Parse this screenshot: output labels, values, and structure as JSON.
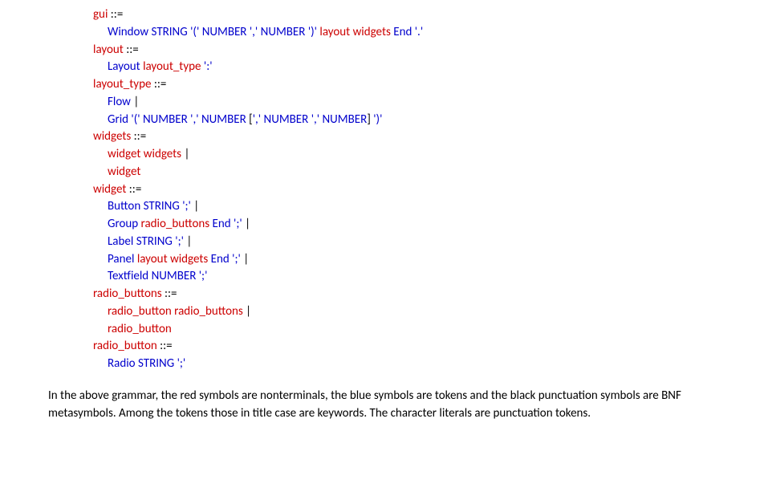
{
  "grammar": {
    "rules": [
      {
        "head": [
          {
            "t": "gui",
            "c": "nt"
          },
          {
            "t": " ",
            "c": "ms"
          },
          {
            "t": "::=",
            "c": "ms"
          }
        ],
        "bodies": [
          [
            {
              "t": "Window",
              "c": "tk"
            },
            {
              "t": " ",
              "c": "ms"
            },
            {
              "t": "STRING",
              "c": "tk"
            },
            {
              "t": " ",
              "c": "ms"
            },
            {
              "t": "'('",
              "c": "tk"
            },
            {
              "t": " ",
              "c": "ms"
            },
            {
              "t": "NUMBER",
              "c": "tk"
            },
            {
              "t": " ",
              "c": "ms"
            },
            {
              "t": "','",
              "c": "tk"
            },
            {
              "t": " ",
              "c": "ms"
            },
            {
              "t": "NUMBER",
              "c": "tk"
            },
            {
              "t": " ",
              "c": "ms"
            },
            {
              "t": "')'",
              "c": "tk"
            },
            {
              "t": " ",
              "c": "ms"
            },
            {
              "t": "layout",
              "c": "nt"
            },
            {
              "t": " ",
              "c": "ms"
            },
            {
              "t": "widgets",
              "c": "nt"
            },
            {
              "t": " ",
              "c": "ms"
            },
            {
              "t": "End",
              "c": "tk"
            },
            {
              "t": " ",
              "c": "ms"
            },
            {
              "t": "'.'",
              "c": "tk"
            }
          ]
        ]
      },
      {
        "head": [
          {
            "t": "layout",
            "c": "nt"
          },
          {
            "t": " ",
            "c": "ms"
          },
          {
            "t": "::=",
            "c": "ms"
          }
        ],
        "bodies": [
          [
            {
              "t": "Layout",
              "c": "tk"
            },
            {
              "t": " ",
              "c": "ms"
            },
            {
              "t": "layout_type",
              "c": "nt"
            },
            {
              "t": " ",
              "c": "ms"
            },
            {
              "t": "':'",
              "c": "tk"
            }
          ]
        ]
      },
      {
        "head": [
          {
            "t": "layout_type",
            "c": "nt"
          },
          {
            "t": " ",
            "c": "ms"
          },
          {
            "t": "::=",
            "c": "ms"
          }
        ],
        "bodies": [
          [
            {
              "t": "Flow",
              "c": "tk"
            },
            {
              "t": " ",
              "c": "ms"
            },
            {
              "t": "|",
              "c": "ms"
            }
          ],
          [
            {
              "t": "Grid",
              "c": "tk"
            },
            {
              "t": " ",
              "c": "ms"
            },
            {
              "t": "'('",
              "c": "tk"
            },
            {
              "t": " ",
              "c": "ms"
            },
            {
              "t": "NUMBER",
              "c": "tk"
            },
            {
              "t": " ",
              "c": "ms"
            },
            {
              "t": "','",
              "c": "tk"
            },
            {
              "t": " ",
              "c": "ms"
            },
            {
              "t": "NUMBER",
              "c": "tk"
            },
            {
              "t": " ",
              "c": "ms"
            },
            {
              "t": "[",
              "c": "ms"
            },
            {
              "t": "','",
              "c": "tk"
            },
            {
              "t": " ",
              "c": "ms"
            },
            {
              "t": "NUMBER",
              "c": "tk"
            },
            {
              "t": " ",
              "c": "ms"
            },
            {
              "t": "','",
              "c": "tk"
            },
            {
              "t": " ",
              "c": "ms"
            },
            {
              "t": "NUMBER",
              "c": "tk"
            },
            {
              "t": "]",
              "c": "ms"
            },
            {
              "t": " ",
              "c": "ms"
            },
            {
              "t": "')'",
              "c": "tk"
            }
          ]
        ]
      },
      {
        "head": [
          {
            "t": "widgets",
            "c": "nt"
          },
          {
            "t": " ",
            "c": "ms"
          },
          {
            "t": "::=",
            "c": "ms"
          }
        ],
        "bodies": [
          [
            {
              "t": "widget",
              "c": "nt"
            },
            {
              "t": " ",
              "c": "ms"
            },
            {
              "t": "widgets",
              "c": "nt"
            },
            {
              "t": " ",
              "c": "ms"
            },
            {
              "t": "|",
              "c": "ms"
            }
          ],
          [
            {
              "t": "widget",
              "c": "nt"
            }
          ]
        ]
      },
      {
        "head": [
          {
            "t": "widget",
            "c": "nt"
          },
          {
            "t": " ",
            "c": "ms"
          },
          {
            "t": "::=",
            "c": "ms"
          }
        ],
        "bodies": [
          [
            {
              "t": "Button",
              "c": "tk"
            },
            {
              "t": " ",
              "c": "ms"
            },
            {
              "t": "STRING",
              "c": "tk"
            },
            {
              "t": " ",
              "c": "ms"
            },
            {
              "t": "';'",
              "c": "tk"
            },
            {
              "t": " ",
              "c": "ms"
            },
            {
              "t": "|",
              "c": "ms"
            }
          ],
          [
            {
              "t": "Group",
              "c": "tk"
            },
            {
              "t": " ",
              "c": "ms"
            },
            {
              "t": "radio_buttons",
              "c": "nt"
            },
            {
              "t": " ",
              "c": "ms"
            },
            {
              "t": "End",
              "c": "tk"
            },
            {
              "t": " ",
              "c": "ms"
            },
            {
              "t": "';'",
              "c": "tk"
            },
            {
              "t": " ",
              "c": "ms"
            },
            {
              "t": "|",
              "c": "ms"
            }
          ],
          [
            {
              "t": "Label",
              "c": "tk"
            },
            {
              "t": " ",
              "c": "ms"
            },
            {
              "t": "STRING",
              "c": "tk"
            },
            {
              "t": " ",
              "c": "ms"
            },
            {
              "t": "';'",
              "c": "tk"
            },
            {
              "t": " ",
              "c": "ms"
            },
            {
              "t": "|",
              "c": "ms"
            }
          ],
          [
            {
              "t": "Panel",
              "c": "tk"
            },
            {
              "t": " ",
              "c": "ms"
            },
            {
              "t": "layout",
              "c": "nt"
            },
            {
              "t": " ",
              "c": "ms"
            },
            {
              "t": "widgets",
              "c": "nt"
            },
            {
              "t": " ",
              "c": "ms"
            },
            {
              "t": "End",
              "c": "tk"
            },
            {
              "t": " ",
              "c": "ms"
            },
            {
              "t": "';'",
              "c": "tk"
            },
            {
              "t": " ",
              "c": "ms"
            },
            {
              "t": "|",
              "c": "ms"
            }
          ],
          [
            {
              "t": "Textfield",
              "c": "tk"
            },
            {
              "t": " ",
              "c": "ms"
            },
            {
              "t": "NUMBER",
              "c": "tk"
            },
            {
              "t": " ",
              "c": "ms"
            },
            {
              "t": "';'",
              "c": "tk"
            }
          ]
        ]
      },
      {
        "head": [
          {
            "t": "radio_buttons",
            "c": "nt"
          },
          {
            "t": " ",
            "c": "ms"
          },
          {
            "t": "::=",
            "c": "ms"
          }
        ],
        "bodies": [
          [
            {
              "t": "radio_button",
              "c": "nt"
            },
            {
              "t": " ",
              "c": "ms"
            },
            {
              "t": "radio_buttons",
              "c": "nt"
            },
            {
              "t": " ",
              "c": "ms"
            },
            {
              "t": "|",
              "c": "ms"
            }
          ],
          [
            {
              "t": "radio_button",
              "c": "nt"
            }
          ]
        ]
      },
      {
        "head": [
          {
            "t": "radio_button",
            "c": "nt"
          },
          {
            "t": " ",
            "c": "ms"
          },
          {
            "t": "::=",
            "c": "ms"
          }
        ],
        "bodies": [
          [
            {
              "t": "Radio",
              "c": "tk"
            },
            {
              "t": " ",
              "c": "ms"
            },
            {
              "t": "STRING",
              "c": "tk"
            },
            {
              "t": " ",
              "c": "ms"
            },
            {
              "t": "';'",
              "c": "tk"
            }
          ]
        ]
      }
    ]
  },
  "paragraph": "In the above grammar, the red symbols are nonterminals, the blue symbols are tokens and the black punctuation symbols are BNF metasymbols. Among the tokens those in title case are keywords. The character literals are punctuation tokens."
}
